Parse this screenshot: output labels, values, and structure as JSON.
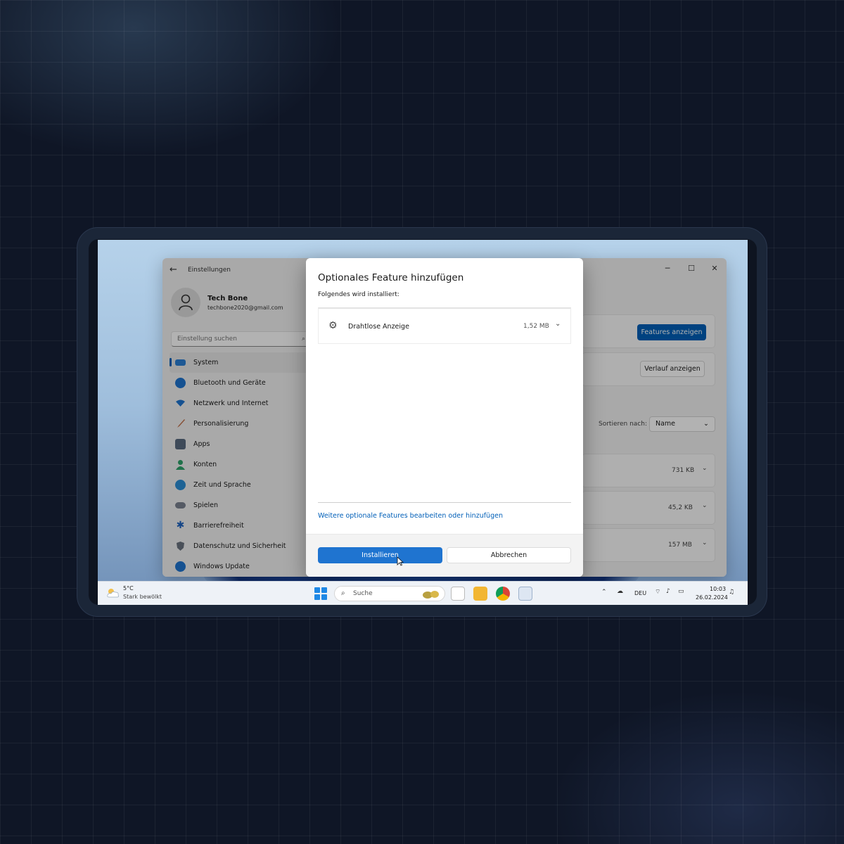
{
  "settings": {
    "app_title": "Einstellungen",
    "profile": {
      "name": "Tech Bone",
      "email": "techbone2020@gmail.com"
    },
    "search_placeholder": "Einstellung suchen",
    "nav": [
      {
        "label": "System",
        "icon": "system-icon",
        "color": "#2a7fd4"
      },
      {
        "label": "Bluetooth und Geräte",
        "icon": "bluetooth-icon",
        "color": "#1f74d0"
      },
      {
        "label": "Netzwerk und Internet",
        "icon": "wifi-icon",
        "color": "#1f74d0"
      },
      {
        "label": "Personalisierung",
        "icon": "brush-icon",
        "color": "#c0704a"
      },
      {
        "label": "Apps",
        "icon": "apps-icon",
        "color": "#5a6a80"
      },
      {
        "label": "Konten",
        "icon": "account-icon",
        "color": "#2ea36a"
      },
      {
        "label": "Zeit und Sprache",
        "icon": "globe-clock-icon",
        "color": "#2b8fd6"
      },
      {
        "label": "Spielen",
        "icon": "gamepad-icon",
        "color": "#7a8290"
      },
      {
        "label": "Barrierefreiheit",
        "icon": "accessibility-icon",
        "color": "#1f64c0"
      },
      {
        "label": "Datenschutz und Sicherheit",
        "icon": "shield-icon",
        "color": "#6b7380"
      },
      {
        "label": "Windows Update",
        "icon": "update-icon",
        "color": "#1f74d0"
      }
    ],
    "right": {
      "features_button": "Features anzeigen",
      "history_button": "Verlauf anzeigen",
      "sort_label": "Sortieren nach:",
      "sort_value": "Name",
      "sizes": [
        "731 KB",
        "45,2 KB",
        "157 MB"
      ]
    }
  },
  "dialog": {
    "title": "Optionales Feature hinzufügen",
    "subtitle": "Folgendes wird installiert:",
    "feature": {
      "name": "Drahtlose Anzeige",
      "size": "1,52 MB"
    },
    "link": "Weitere optionale Features bearbeiten oder hinzufügen",
    "install_button": "Installieren",
    "cancel_button": "Abbrechen"
  },
  "taskbar": {
    "weather": {
      "temp": "5°C",
      "condition": "Stark bewölkt"
    },
    "search_placeholder": "Suche",
    "language": "DEU",
    "time": "10:03",
    "date": "26.02.2024"
  }
}
